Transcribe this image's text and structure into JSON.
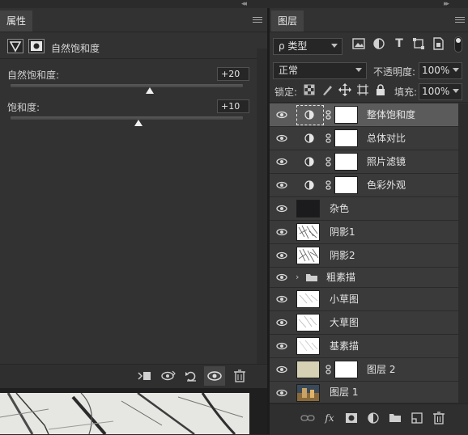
{
  "properties_panel": {
    "tab_label": "属性",
    "adjustment_title": "自然饱和度",
    "vibrance": {
      "label": "自然饱和度:",
      "value": "+20",
      "slider_fraction": 0.5
    },
    "saturation": {
      "label": "饱和度:",
      "value": "+10",
      "slider_fraction": 0.5
    },
    "bottom_icons": [
      "clip-to-layer-icon",
      "view-previous-state-icon",
      "reset-icon",
      "visibility-eye-icon",
      "trash-icon"
    ]
  },
  "layers_panel": {
    "tab_label": "图层",
    "filter_kind": "ρ 类型",
    "filter_icons": [
      "image-filter-icon",
      "adjustment-filter-icon",
      "type-filter-icon",
      "shape-filter-icon",
      "smart-object-filter-icon"
    ],
    "blend_mode": "正常",
    "opacity_label": "不透明度:",
    "opacity_value": "100%",
    "lock_label": "锁定:",
    "lock_icons": [
      "lock-transparency-icon",
      "lock-image-icon",
      "lock-position-icon",
      "lock-artboard-icon",
      "lock-all-icon"
    ],
    "fill_label": "填充:",
    "fill_value": "100%",
    "layers": [
      {
        "name": "整体饱和度",
        "type": "adjustment",
        "selected": true
      },
      {
        "name": "总体对比",
        "type": "adjustment",
        "indented": true
      },
      {
        "name": "照片滤镜",
        "type": "adjustment",
        "indented": true
      },
      {
        "name": "色彩外观",
        "type": "adjustment",
        "indented": true
      },
      {
        "name": "杂色",
        "type": "raster",
        "thumb": "dark"
      },
      {
        "name": "阴影1",
        "type": "raster",
        "thumb": "sketch"
      },
      {
        "name": "阴影2",
        "type": "raster",
        "thumb": "sketch"
      },
      {
        "name": "粗素描",
        "type": "group"
      },
      {
        "name": "小草图",
        "type": "raster",
        "thumb": "sketch-light"
      },
      {
        "name": "大草图",
        "type": "raster",
        "thumb": "sketch-light"
      },
      {
        "name": "基素描",
        "type": "raster",
        "thumb": "sketch-light"
      },
      {
        "name": "图层 2",
        "type": "masked",
        "thumb": "beige"
      },
      {
        "name": "图层 1",
        "type": "raster",
        "thumb": "photo"
      }
    ],
    "footer_icons": [
      "link-layers-icon",
      "fx-icon",
      "add-mask-icon",
      "new-adjustment-icon",
      "new-group-icon",
      "new-layer-icon",
      "delete-layer-icon"
    ]
  },
  "colors": {
    "panel_bg": "#323232",
    "tab_active": "#424242",
    "selected_row": "#5b5b5b",
    "input_bg": "#262626"
  }
}
